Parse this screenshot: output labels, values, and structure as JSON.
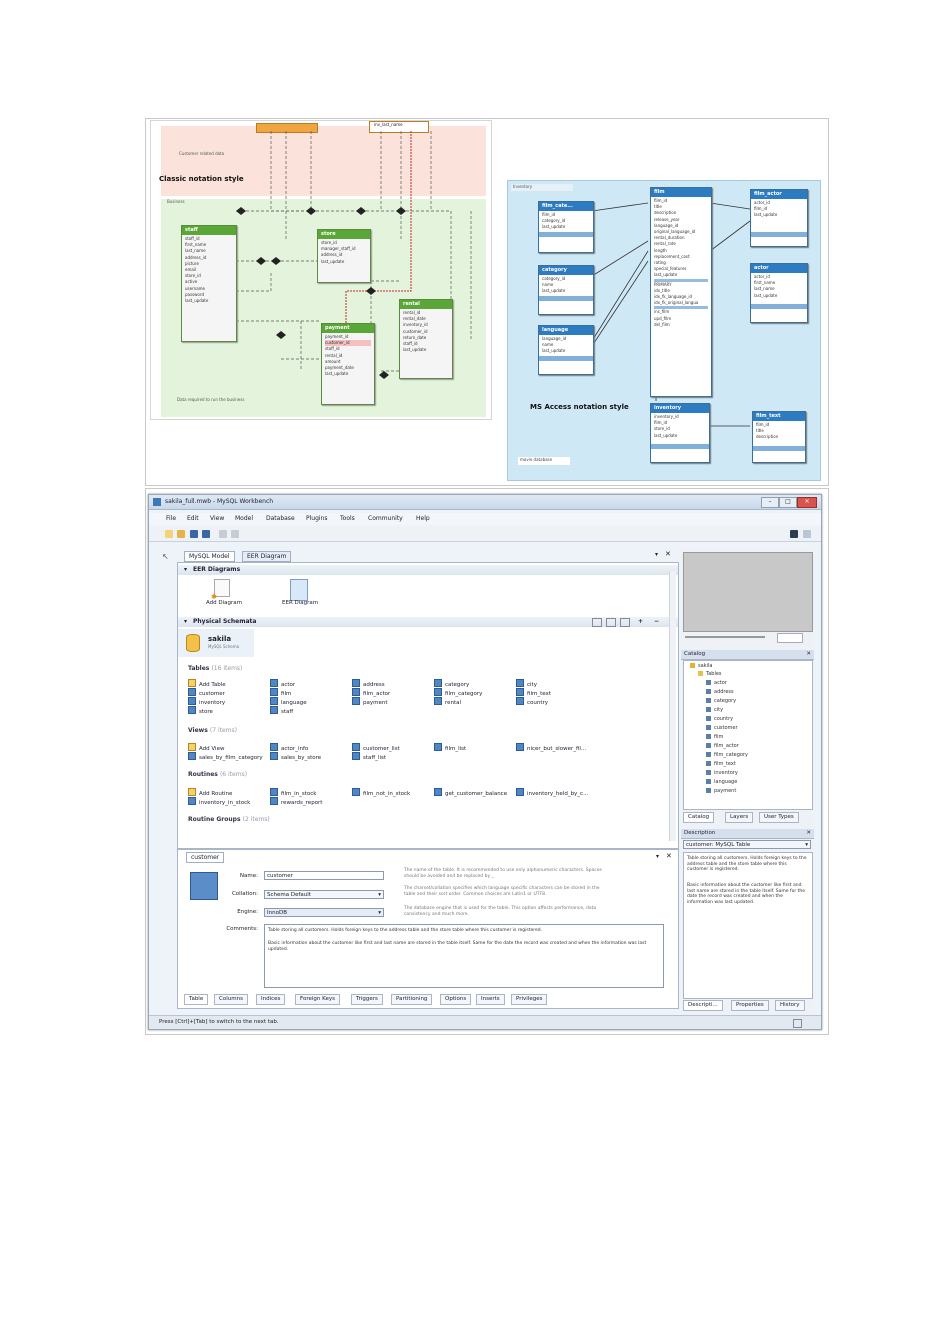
{
  "classic": {
    "title": "Classic notation style",
    "region_customer": "Customer related data",
    "region_business": "Business",
    "region_business_note": "Data required to run the business",
    "top_label": "inv_last_name",
    "staff": {
      "name": "staff",
      "cols": [
        "staff_id",
        "first_name",
        "last_name",
        "address_id",
        "picture",
        "email",
        "store_id",
        "active",
        "username",
        "password",
        "last_update"
      ]
    },
    "store": {
      "name": "store",
      "cols": [
        "store_id",
        "manager_staff_id",
        "address_id",
        "last_update"
      ]
    },
    "payment": {
      "name": "payment",
      "cols": [
        "payment_id",
        "customer_id",
        "staff_id",
        "rental_id",
        "amount",
        "payment_date",
        "last_update"
      ]
    },
    "rental": {
      "name": "rental",
      "cols": [
        "rental_id",
        "rental_date",
        "inventory_id",
        "customer_id",
        "return_date",
        "staff_id",
        "last_update"
      ]
    }
  },
  "access": {
    "title": "MS Access notation style",
    "region_inventory": "Inventory",
    "region_movie": "movie database",
    "film_category": {
      "name": "film_cate...",
      "cols": [
        "film_id",
        "category_id",
        "last_update"
      ]
    },
    "category": {
      "name": "category",
      "cols": [
        "category_id",
        "name",
        "last_update"
      ]
    },
    "language": {
      "name": "language",
      "cols": [
        "language_id",
        "name",
        "last_update"
      ]
    },
    "film": {
      "name": "film",
      "cols": [
        "film_id",
        "title",
        "description",
        "release_year",
        "language_id",
        "original_language_id",
        "rental_duration",
        "rental_rate",
        "length",
        "replacement_cost",
        "rating",
        "special_features",
        "last_update"
      ],
      "extra": [
        "PRIMARY",
        "idx_title",
        "idx_fk_language_id",
        "idx_fk_original_langua"
      ],
      "extra2": [
        "ins_film",
        "upd_film",
        "del_film"
      ]
    },
    "film_actor": {
      "name": "film_actor",
      "cols": [
        "actor_id",
        "film_id",
        "last_update"
      ]
    },
    "actor": {
      "name": "actor",
      "cols": [
        "actor_id",
        "first_name",
        "last_name",
        "last_update"
      ]
    },
    "inventory": {
      "name": "inventory",
      "cols": [
        "inventory_id",
        "film_id",
        "store_id",
        "last_update"
      ]
    },
    "film_text": {
      "name": "film_text",
      "cols": [
        "film_id",
        "title",
        "description"
      ]
    }
  },
  "workbench": {
    "title": "sakila_full.mwb - MySQL Workbench",
    "menu": [
      "File",
      "Edit",
      "View",
      "Model",
      "Database",
      "Plugins",
      "Tools",
      "Community",
      "Help"
    ],
    "tabs": [
      "MySQL Model",
      "EER Diagram"
    ],
    "eer_section": "EER Diagrams",
    "add_diagram": "Add Diagram",
    "eer_diagram": "EER Diagram",
    "physical_section": "Physical Schemata",
    "schema_name": "sakila",
    "schema_sub": "MySQL Schema",
    "tables_label": "Tables",
    "tables_count": "(16 items)",
    "tables": [
      "Add Table",
      "actor",
      "address",
      "category",
      "city",
      "country",
      "customer",
      "film",
      "film_actor",
      "film_category",
      "film_text",
      "inventory",
      "language",
      "payment",
      "rental",
      "staff",
      "store"
    ],
    "views_label": "Views",
    "views_count": "(7 items)",
    "views": [
      "Add View",
      "actor_info",
      "customer_list",
      "film_list",
      "nicer_but_slower_fil...",
      "sales_by_film_category",
      "sales_by_store",
      "staff_list"
    ],
    "routines_label": "Routines",
    "routines_count": "(6 items)",
    "routines": [
      "Add Routine",
      "film_in_stock",
      "film_not_in_stock",
      "get_customer_balance",
      "inventory_held_by_c...",
      "inventory_in_stock",
      "rewards_report"
    ],
    "routine_groups_label": "Routine Groups",
    "routine_groups_count": "(2 items)",
    "editor_tab": "customer",
    "name_label": "Name:",
    "name_value": "customer",
    "collation_label": "Collation:",
    "collation_value": "Schema Default",
    "engine_label": "Engine:",
    "engine_value": "InnoDB",
    "comments_label": "Comments:",
    "name_hint": "The name of the table. It is recommended to use only alphanumeric characters. Spaces should be avoided and be replaced by _",
    "collation_hint": "The charset/collation specifies which language specific characters can be stored in the table and their sort order. Common choices are Latin1 or UTF8.",
    "engine_hint": "The database engine that is used for the table. This option affects performance, data consistency and much more.",
    "comment_1": "Table storing all customers. Holds foreign keys to the address table and the store table where this customer is registered.",
    "comment_2": "Basic information about the customer like first and last name are stored in the table itself. Same for the date the record was created and when the information was last updated.",
    "bottom_tabs": [
      "Table",
      "Columns",
      "Indices",
      "Foreign Keys",
      "Triggers",
      "Partitioning",
      "Options",
      "Inserts",
      "Privileges"
    ],
    "status": "Press [Ctrl]+[Tab] to switch to the next tab.",
    "catalog_label": "Catalog",
    "catalog_root": "sakila",
    "catalog_tables": "Tables",
    "catalog_items": [
      "actor",
      "address",
      "category",
      "city",
      "country",
      "customer",
      "film",
      "film_actor",
      "film_category",
      "film_text",
      "inventory",
      "language",
      "payment"
    ],
    "catalog_tabs": [
      "Catalog",
      "Layers",
      "User Types"
    ],
    "description_label": "Description",
    "description_select": "customer: MySQL Table",
    "description_1": "Table storing all customers. Holds foreign keys to the address table and the store table where this customer is registered.",
    "description_2": "Basic information about the customer like first and last name are stored in the table itself. Same for the date the record was created and when the information was last updated.",
    "desc_tabs": [
      "Descripti...",
      "Properties",
      "History"
    ]
  }
}
